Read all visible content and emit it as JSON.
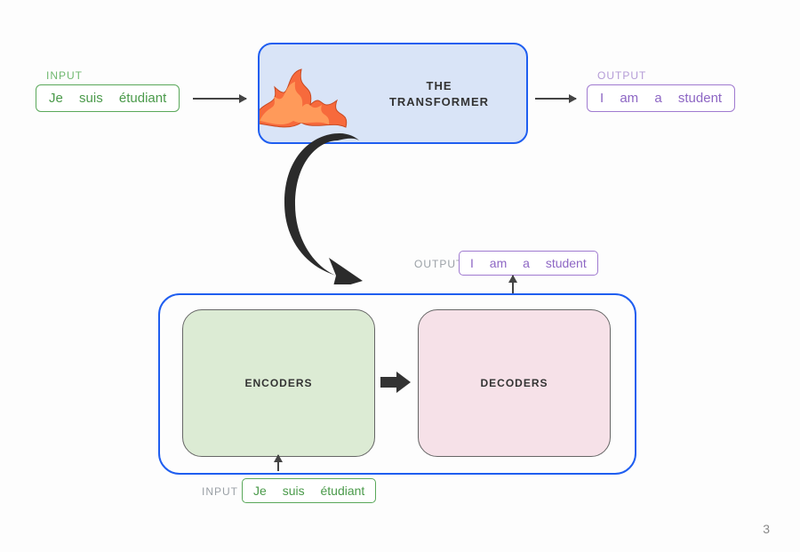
{
  "labels": {
    "input": "INPUT",
    "output": "OUTPUT"
  },
  "tokens": {
    "source": [
      "Je",
      "suis",
      "étudiant"
    ],
    "target": [
      "I",
      "am",
      "a",
      "student"
    ]
  },
  "transformer": {
    "title": "THE TRANSFORMER"
  },
  "blocks": {
    "encoders": "ENCODERS",
    "decoders": "DECODERS"
  },
  "page_number": "3",
  "colors": {
    "input_border": "#5aa85a",
    "output_border": "#a07ad0",
    "transformer_border": "#1f5ef0",
    "transformer_fill": "#d9e4f7",
    "encoder_fill": "#dcebd4",
    "decoder_fill": "#f6e1e8"
  }
}
